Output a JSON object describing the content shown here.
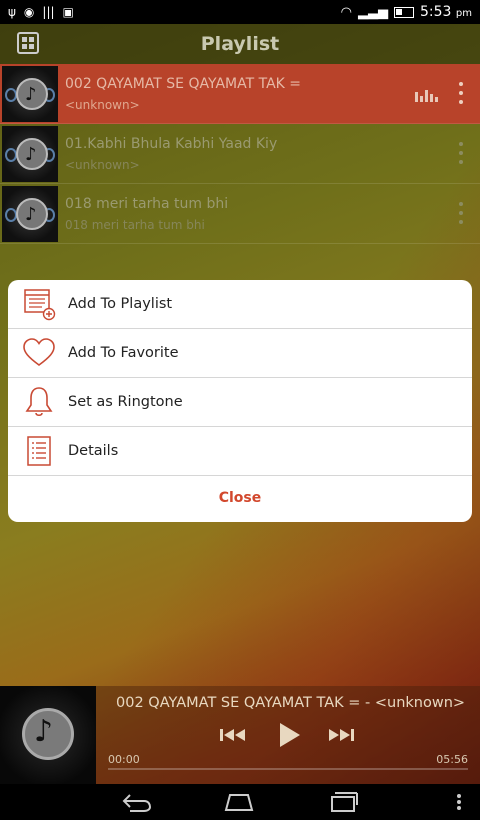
{
  "status_bar": {
    "time": "5:53",
    "ampm": "pm"
  },
  "app_bar": {
    "title": "Playlist"
  },
  "songs": [
    {
      "title": "002 QAYAMAT SE QAYAMAT TAK =",
      "subtitle": "<unknown>",
      "active": true
    },
    {
      "title": "01.Kabhi Bhula Kabhi Yaad Kiy",
      "subtitle": "<unknown>",
      "active": false
    },
    {
      "title": "018 meri tarha tum bhi",
      "subtitle": "018 meri tarha tum bhi",
      "active": false
    }
  ],
  "dialog": {
    "items": [
      {
        "label": "Add To Playlist",
        "icon": "playlist-add-icon"
      },
      {
        "label": "Add To Favorite",
        "icon": "heart-icon"
      },
      {
        "label": "Set as Ringtone",
        "icon": "bell-icon"
      },
      {
        "label": "Details",
        "icon": "details-list-icon"
      }
    ],
    "close_label": "Close"
  },
  "player": {
    "now_playing": "002 QAYAMAT SE QAYAMAT TAK = - <unknown>",
    "elapsed": "00:00",
    "duration": "05:56",
    "progress": 0
  },
  "colors": {
    "active_row": "#b8432a",
    "accent": "#d2482d"
  }
}
